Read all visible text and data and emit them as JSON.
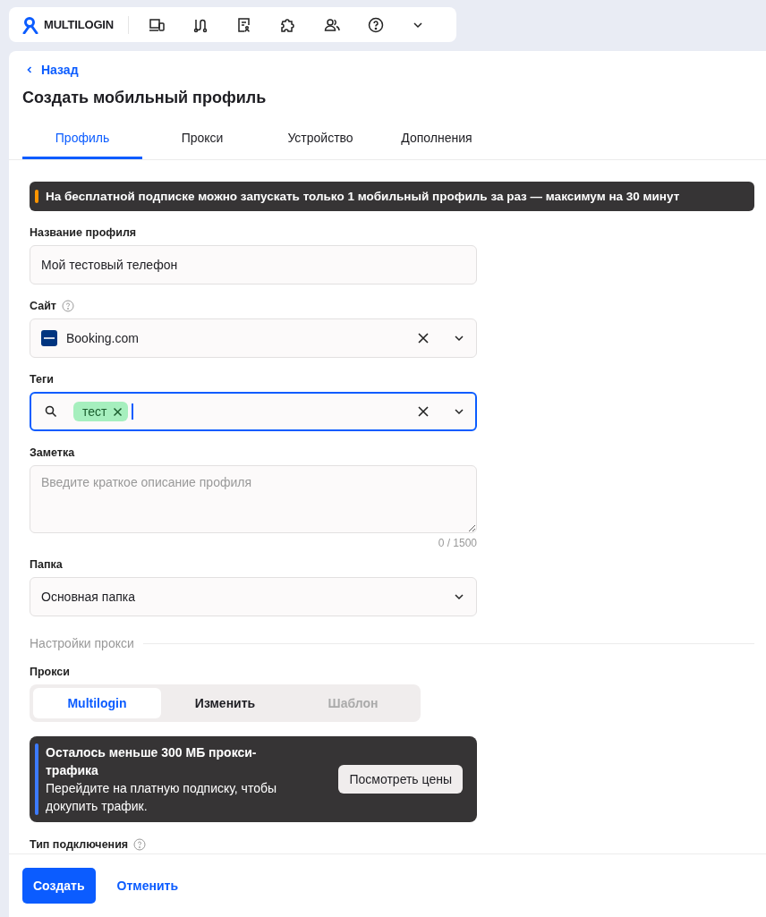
{
  "brand": {
    "name": "MULTILOGIN"
  },
  "back_link": "Назад",
  "title": "Создать мобильный профиль",
  "tabs": [
    {
      "label": "Профиль",
      "selected": true
    },
    {
      "label": "Прокси",
      "selected": false
    },
    {
      "label": "Устройство",
      "selected": false
    },
    {
      "label": "Дополнения",
      "selected": false
    }
  ],
  "warning_banner": "На бесплатной подписке можно запускать только 1 мобильный профиль за раз — максимум на 30 минут",
  "profile_name": {
    "label": "Название профиля",
    "value": "Мой тестовый телефон"
  },
  "site": {
    "label": "Сайт",
    "value": "Booking.com"
  },
  "tags": {
    "label": "Теги",
    "focused": true,
    "items": [
      {
        "label": "тест",
        "color": "#a6efbe"
      }
    ]
  },
  "note": {
    "label": "Заметка",
    "placeholder": "Введите краткое описание профиля",
    "counter": "0 / 1500"
  },
  "folder": {
    "label": "Папка",
    "value": "Основная папка"
  },
  "proxy_section": "Настройки прокси",
  "proxy": {
    "label": "Прокси",
    "options": [
      {
        "label": "Multilogin",
        "selected": true,
        "disabled": false
      },
      {
        "label": "Изменить",
        "selected": false,
        "disabled": false
      },
      {
        "label": "Шаблон",
        "selected": false,
        "disabled": true
      }
    ]
  },
  "traffic_alert": {
    "title": "Осталось меньше 300 МБ прокси-трафика",
    "text": "Перейдите на платную подписку, чтобы докупить трафик.",
    "button": "Посмотреть цены"
  },
  "connection_type": {
    "label": "Тип подключения"
  },
  "footer": {
    "primary": "Создать",
    "secondary": "Отменить"
  }
}
